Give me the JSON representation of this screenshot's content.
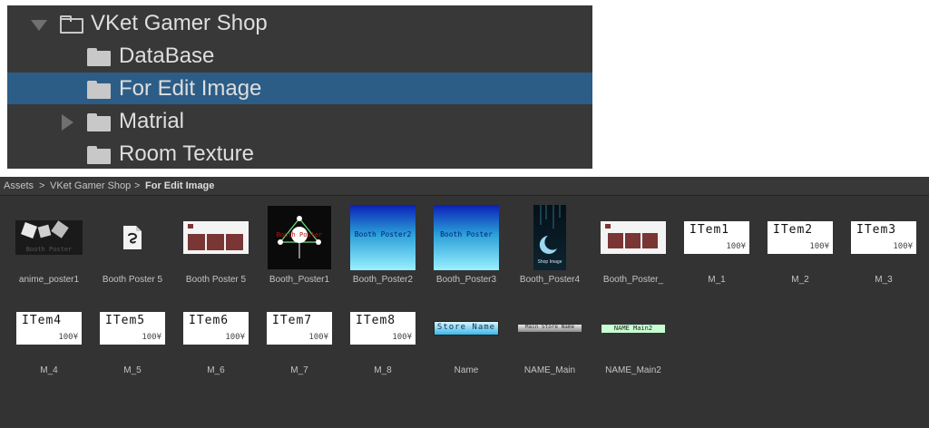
{
  "tree": {
    "root": {
      "label": "VKet Gamer Shop",
      "expanded": true
    },
    "children": [
      {
        "label": "DataBase",
        "selected": false,
        "has_children": false
      },
      {
        "label": "For Edit Image",
        "selected": true,
        "has_children": false
      },
      {
        "label": "Matrial",
        "selected": false,
        "has_children": true
      },
      {
        "label": "Room Texture",
        "selected": false,
        "has_children": false
      }
    ],
    "selection_color": "#2c5d87"
  },
  "breadcrumb": {
    "items": [
      "Assets",
      "VKet Gamer Shop",
      "For Edit Image"
    ],
    "separator": ">"
  },
  "assets": [
    {
      "name": "anime_poster1",
      "thumb_text": "Booth Poster"
    },
    {
      "name": "Booth Poster 5",
      "icon": "clip-studio-file-icon"
    },
    {
      "name": "Booth Poster 5"
    },
    {
      "name": "Booth_Poster1",
      "thumb_text": "Booth Poster"
    },
    {
      "name": "Booth_Poster2",
      "thumb_text": "Booth Poster2"
    },
    {
      "name": "Booth_Poster3",
      "thumb_text": "Booth Poster"
    },
    {
      "name": "Booth_Poster4",
      "thumb_text": "Shop Image"
    },
    {
      "name": "Booth_Poster_"
    },
    {
      "name": "M_1",
      "thumb_text": "ITem1",
      "price": "100¥"
    },
    {
      "name": "M_2",
      "thumb_text": "ITem2",
      "price": "100¥"
    },
    {
      "name": "M_3",
      "thumb_text": "ITem3",
      "price": "100¥"
    },
    {
      "name": "M_4",
      "thumb_text": "ITem4",
      "price": "100¥"
    },
    {
      "name": "M_5",
      "thumb_text": "ITem5",
      "price": "100¥"
    },
    {
      "name": "M_6",
      "thumb_text": "ITem6",
      "price": "100¥"
    },
    {
      "name": "M_7",
      "thumb_text": "ITem7",
      "price": "100¥"
    },
    {
      "name": "M_8",
      "thumb_text": "ITem8",
      "price": "100¥"
    },
    {
      "name": "Name",
      "thumb_text": "Store Name"
    },
    {
      "name": "NAME_Main",
      "thumb_text": "Main Store Name"
    },
    {
      "name": "NAME_Main2",
      "thumb_text": "NAME Main2"
    }
  ]
}
